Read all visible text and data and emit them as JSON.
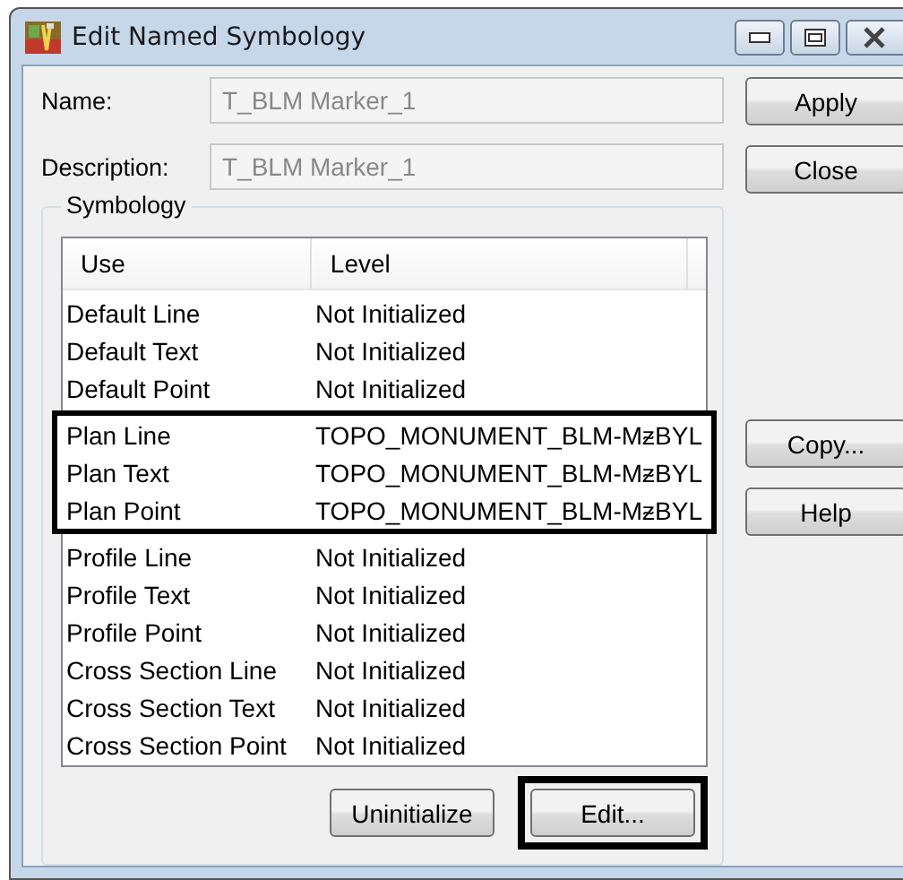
{
  "window": {
    "title": "Edit Named Symbology"
  },
  "fields": [
    {
      "label": "Name:",
      "value": "T_BLM Marker_1",
      "disabled": true
    },
    {
      "label": "Description:",
      "value": "T_BLM Marker_1",
      "disabled": true
    }
  ],
  "side_buttons_top": [
    "Apply",
    "Close"
  ],
  "side_buttons_middle": [
    "Copy...",
    "Help"
  ],
  "symbology": {
    "title": "Symbology",
    "table": {
      "columns": [
        "Use",
        "Level"
      ],
      "rows": [
        {
          "use": "Default Line",
          "level": "Not Initialized",
          "highlighted": false
        },
        {
          "use": "Default Text",
          "level": "Not Initialized",
          "highlighted": false
        },
        {
          "use": "Default Point",
          "level": "Not Initialized",
          "highlighted": false
        },
        {
          "use": "Plan Line",
          "level": "TOPO_MONUMENT_BLM-MᵶBYL",
          "highlighted": true
        },
        {
          "use": "Plan Text",
          "level": "TOPO_MONUMENT_BLM-MᵶBYL",
          "highlighted": true
        },
        {
          "use": "Plan Point",
          "level": "TOPO_MONUMENT_BLM-MᵶBYL",
          "highlighted": true
        },
        {
          "use": "Profile Line",
          "level": "Not Initialized",
          "highlighted": false
        },
        {
          "use": "Profile Text",
          "level": "Not Initialized",
          "highlighted": false
        },
        {
          "use": "Profile Point",
          "level": "Not Initialized",
          "highlighted": false
        },
        {
          "use": "Cross Section Line",
          "level": "Not Initialized",
          "highlighted": false
        },
        {
          "use": "Cross Section Text",
          "level": "Not Initialized",
          "highlighted": false
        },
        {
          "use": "Cross Section Point",
          "level": "Not Initialized",
          "highlighted": false
        }
      ]
    },
    "buttons": [
      {
        "label": "Uninitialize",
        "highlighted": false
      },
      {
        "label": "Edit...",
        "highlighted": true
      }
    ]
  }
}
